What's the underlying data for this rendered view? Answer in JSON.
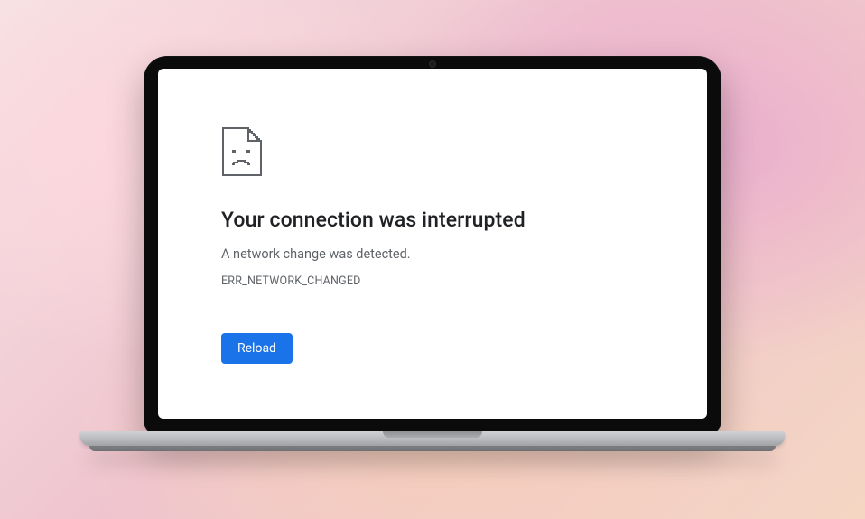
{
  "error": {
    "heading": "Your connection was interrupted",
    "subtext": "A network change was detected.",
    "code": "ERR_NETWORK_CHANGED",
    "reload_label": "Reload"
  },
  "colors": {
    "accent": "#1a73e8",
    "text": "#202124",
    "muted": "#5f6368"
  }
}
